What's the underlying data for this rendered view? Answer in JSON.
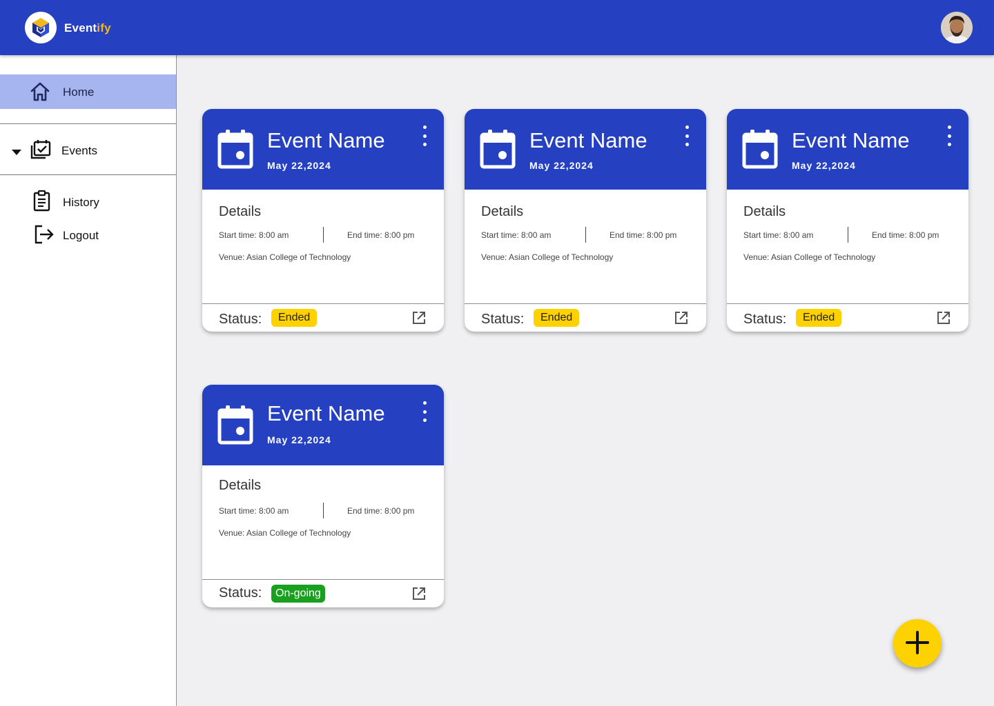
{
  "header": {
    "brand_prefix": "Event",
    "brand_suffix": "ify",
    "logo_icon": "cube-logo-icon",
    "avatar_icon": "user-avatar"
  },
  "sidebar": {
    "items": [
      {
        "label": "Home",
        "icon": "home-icon",
        "active": true
      },
      {
        "label": "Events",
        "icon": "calendar-check-icon",
        "expandable": true
      },
      {
        "label": "History",
        "icon": "clipboard-icon"
      },
      {
        "label": "Logout",
        "icon": "logout-icon"
      }
    ]
  },
  "cards": [
    {
      "title": "Event Name",
      "date": "May 22,2024",
      "details_title": "Details",
      "start_time": "Start time: 8:00 am",
      "end_time": "End time: 8:00 pm",
      "venue": "Venue: Asian College of Technology",
      "status_label": "Status:",
      "status": "Ended"
    },
    {
      "title": "Event Name",
      "date": "May 22,2024",
      "details_title": "Details",
      "start_time": "Start time: 8:00 am",
      "end_time": "End time: 8:00 pm",
      "venue": "Venue: Asian College of Technology",
      "status_label": "Status:",
      "status": "Ended"
    },
    {
      "title": "Event Name",
      "date": "May 22,2024",
      "details_title": "Details",
      "start_time": "Start time: 8:00 am",
      "end_time": "End time: 8:00 pm",
      "venue": "Venue: Asian College of Technology",
      "status_label": "Status:",
      "status": "Ended"
    },
    {
      "title": "Event Name",
      "date": "May 22,2024",
      "details_title": "Details",
      "start_time": "Start time: 8:00 am",
      "end_time": "End time: 8:00 pm",
      "venue": "Venue: Asian College of Technology",
      "status_label": "Status:",
      "status": "On-going"
    }
  ],
  "fab": {
    "icon": "plus-icon"
  },
  "colors": {
    "primary": "#2541c1",
    "accent": "#f5b81c",
    "nav_active": "#a6b4f0",
    "status_ended": "#fed100",
    "status_ongoing": "#19a01f",
    "background": "#f0f0f2"
  }
}
